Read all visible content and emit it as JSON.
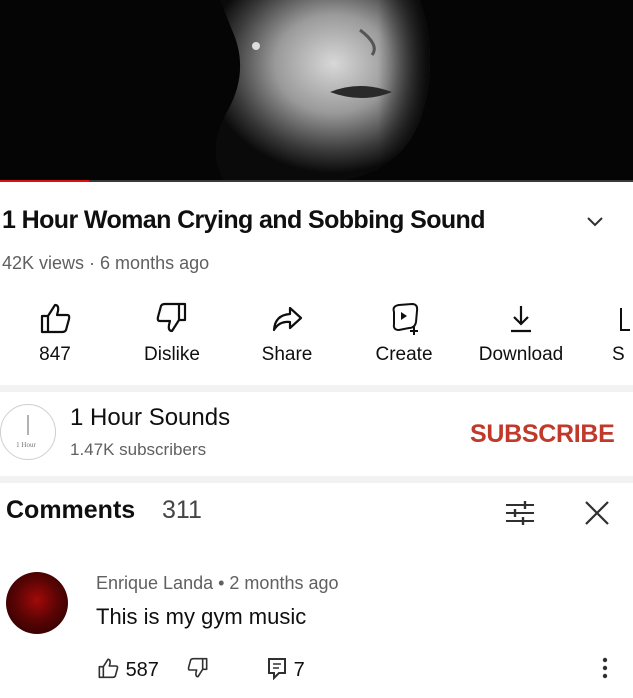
{
  "video": {
    "title": "1 Hour Woman Crying and Sobbing Sound",
    "views": "42K views",
    "separator": " · ",
    "age": "6 months ago",
    "progress_fraction": 0.14
  },
  "actions": [
    {
      "label": "847",
      "icon": "thumbs-up-icon"
    },
    {
      "label": "Dislike",
      "icon": "thumbs-down-icon"
    },
    {
      "label": "Share",
      "icon": "share-icon"
    },
    {
      "label": "Create",
      "icon": "create-icon"
    },
    {
      "label": "Download",
      "icon": "download-icon"
    },
    {
      "label": "S",
      "icon": "save-icon"
    }
  ],
  "channel": {
    "name": "1 Hour Sounds",
    "subscribers": "1.47K subscribers",
    "avatar_text": "1 Hour",
    "subscribe_label": "SUBSCRIBE"
  },
  "comments": {
    "heading": "Comments",
    "count": "311",
    "items": [
      {
        "author": "Enrique Landa",
        "separator": " • ",
        "age": "2 months ago",
        "text": "This is my gym music",
        "likes": "587",
        "replies": "7"
      }
    ]
  },
  "colors": {
    "subscribe": "#c0392b",
    "progress": "#dd1111",
    "avatar": "#a10a0a"
  }
}
